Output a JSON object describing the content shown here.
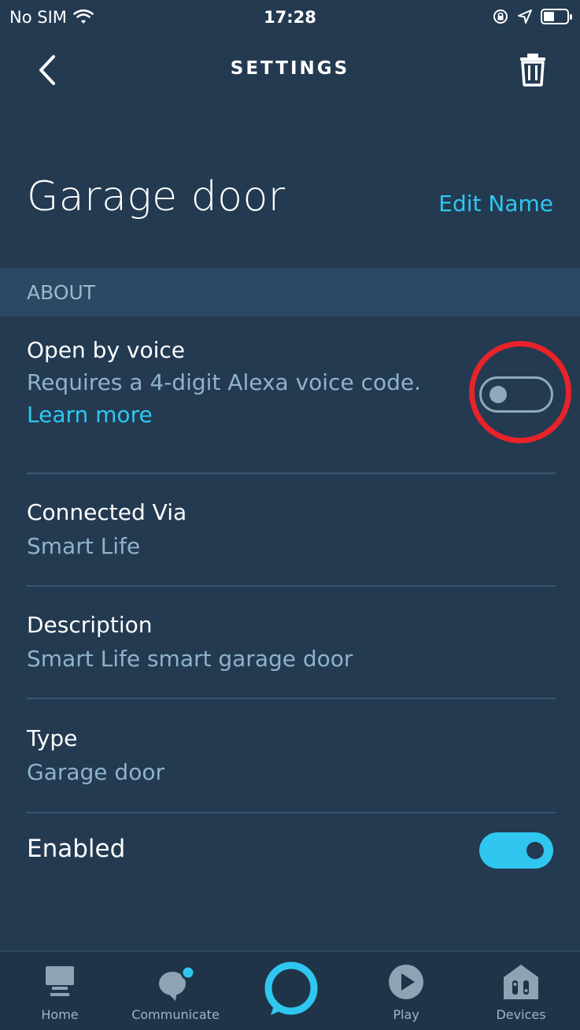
{
  "status_bar": {
    "carrier": "No SIM",
    "time": "17:28",
    "icons": [
      "wifi-icon",
      "orientation-lock-icon",
      "location-icon",
      "battery-icon"
    ]
  },
  "nav": {
    "title": "SETTINGS",
    "back_icon": "chevron-left-icon",
    "delete_icon": "trash-icon"
  },
  "device": {
    "name": "Garage door",
    "edit_label": "Edit Name"
  },
  "about": {
    "header": "ABOUT",
    "open_by_voice": {
      "label": "Open by voice",
      "description": "Requires a 4-digit Alexa voice code.",
      "link": "Learn more",
      "enabled": false
    },
    "connected_via": {
      "label": "Connected Via",
      "value": "Smart Life"
    },
    "description": {
      "label": "Description",
      "value": "Smart Life smart garage door"
    },
    "type": {
      "label": "Type",
      "value": "Garage door"
    },
    "enabled": {
      "label": "Enabled",
      "enabled": true
    }
  },
  "tabs": [
    {
      "label": "Home",
      "icon": "home-icon"
    },
    {
      "label": "Communicate",
      "icon": "chat-bubble-icon"
    },
    {
      "label": "",
      "icon": "alexa-ring-icon"
    },
    {
      "label": "Play",
      "icon": "play-icon"
    },
    {
      "label": "Devices",
      "icon": "devices-icon"
    }
  ],
  "colors": {
    "background": "#233a51",
    "accent": "#2fc7f0",
    "highlight": "#e8232a",
    "secondary_text": "#8fb3c9"
  }
}
